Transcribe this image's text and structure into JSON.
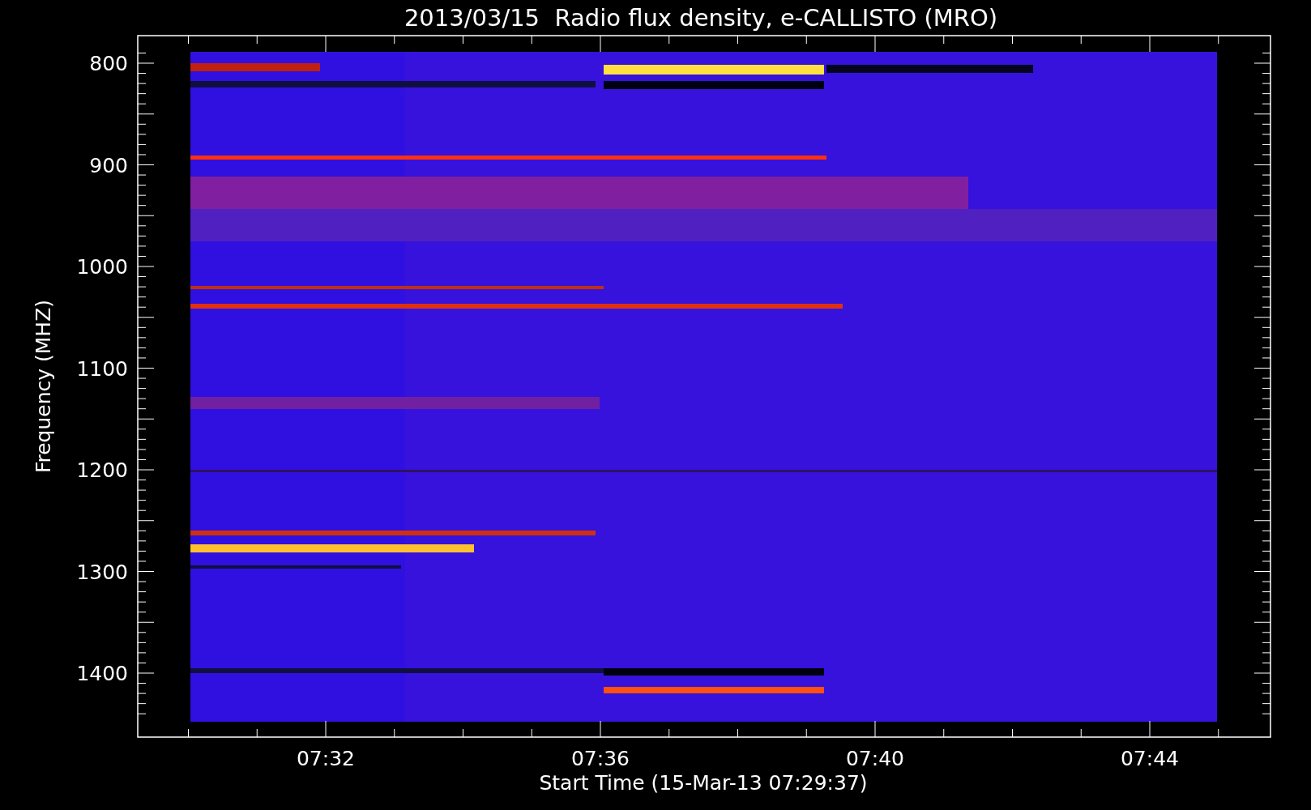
{
  "title": "2013/03/15  Radio flux density, e-CALLISTO (MRO)",
  "y_axis": {
    "label": "Frequency (MHZ)",
    "ticks": [
      "800",
      "900",
      "1000",
      "1100",
      "1200",
      "1300",
      "1400"
    ]
  },
  "x_axis": {
    "label": "Start Time (15-Mar-13 07:29:37)",
    "ticks": [
      "07:32",
      "07:36",
      "07:40",
      "07:44"
    ]
  }
}
